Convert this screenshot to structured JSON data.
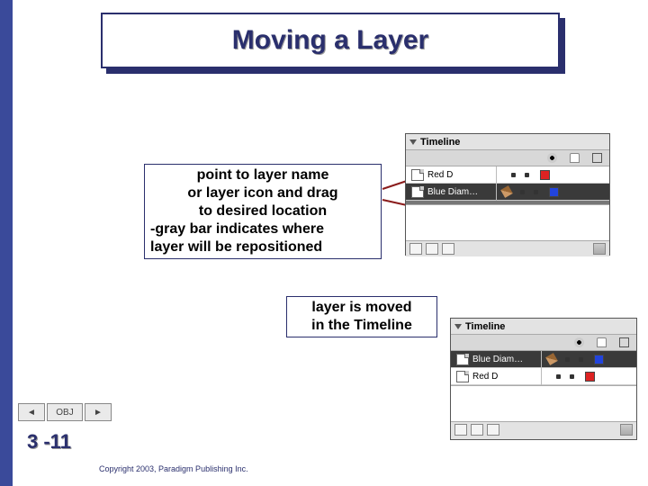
{
  "title": "Moving a Layer",
  "callout1": {
    "l1": "point to layer name",
    "l2": "or layer icon and drag",
    "l3": "to desired location",
    "l4": "-gray bar indicates where",
    "l5": "layer will be repositioned"
  },
  "callout2": {
    "l1": "layer is moved",
    "l2": "in the Timeline"
  },
  "panel1": {
    "title": "Timeline",
    "rows": [
      {
        "name": "Red D",
        "swatch": "sw-red"
      },
      {
        "name": "Blue Diam…",
        "swatch": "sw-blue"
      }
    ]
  },
  "panel2": {
    "title": "Timeline",
    "rows": [
      {
        "name": "Blue Diam…",
        "swatch": "sw-blue"
      },
      {
        "name": "Red D",
        "swatch": "sw-red"
      }
    ]
  },
  "nav": {
    "obj": "OBJ"
  },
  "page_number": "3 -11",
  "copyright": "Copyright 2003, Paradigm Publishing Inc."
}
